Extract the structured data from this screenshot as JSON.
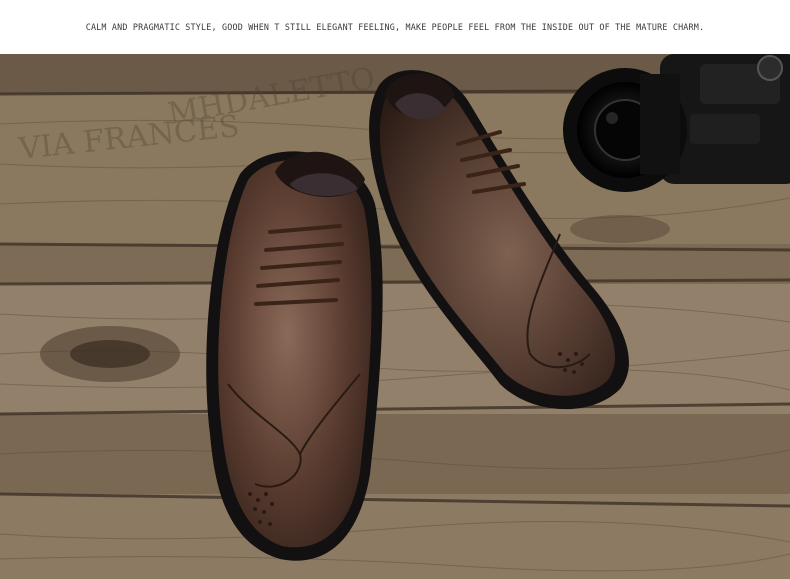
{
  "caption": "CALM AND PRAGMATIC STYLE, GOOD WHEN T STILL ELEGANT FEELING, MAKE PEOPLE FEEL FROM THE INSIDE OUT OF THE MATURE CHARM.",
  "photo": {
    "subject": "pair of brown leather brogue oxford shoes with a camera on a weathered wooden floor",
    "colors": {
      "wood_light": "#9c8a72",
      "wood_dark": "#3e3226",
      "leather": "#4a3026",
      "leather_highlight": "#8a6a58",
      "sole": "#151210",
      "camera": "#141414"
    }
  }
}
